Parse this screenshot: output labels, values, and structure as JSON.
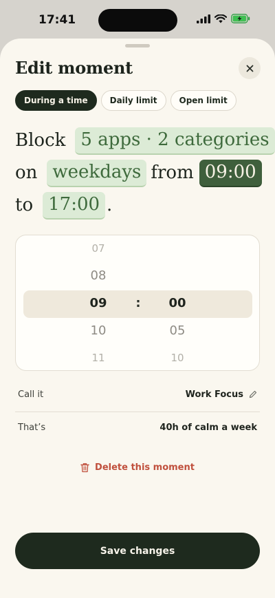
{
  "status_bar": {
    "time": "17:41"
  },
  "sheet": {
    "title": "Edit moment",
    "tabs": [
      {
        "label": "During a time",
        "active": true
      },
      {
        "label": "Daily limit",
        "active": false
      },
      {
        "label": "Open limit",
        "active": false
      }
    ],
    "sentence": {
      "word_block": "Block",
      "apps_chip": "5 apps · 2 categories",
      "word_on": "on",
      "days_chip": "weekdays",
      "word_from": "from",
      "start_chip": "09:00",
      "word_to": "to",
      "end_chip": "17:00",
      "period": "."
    },
    "picker": {
      "hours": [
        "07",
        "08",
        "09",
        "10",
        "11"
      ],
      "minutes": [
        "00",
        "05",
        "10"
      ],
      "separator": ":"
    },
    "name_row": {
      "label": "Call it",
      "value": "Work Focus"
    },
    "summary_row": {
      "label": "That’s",
      "value": "40h of calm a week"
    },
    "delete_label": "Delete this moment",
    "save_label": "Save changes"
  },
  "colors": {
    "sheet_bg": "#faf7ef",
    "primary_dark": "#1e2a1e",
    "chip_bg": "#dcebd6",
    "chip_text": "#3e6a3c",
    "chip_dark_bg": "#3f5f3c",
    "danger": "#c0503d"
  }
}
